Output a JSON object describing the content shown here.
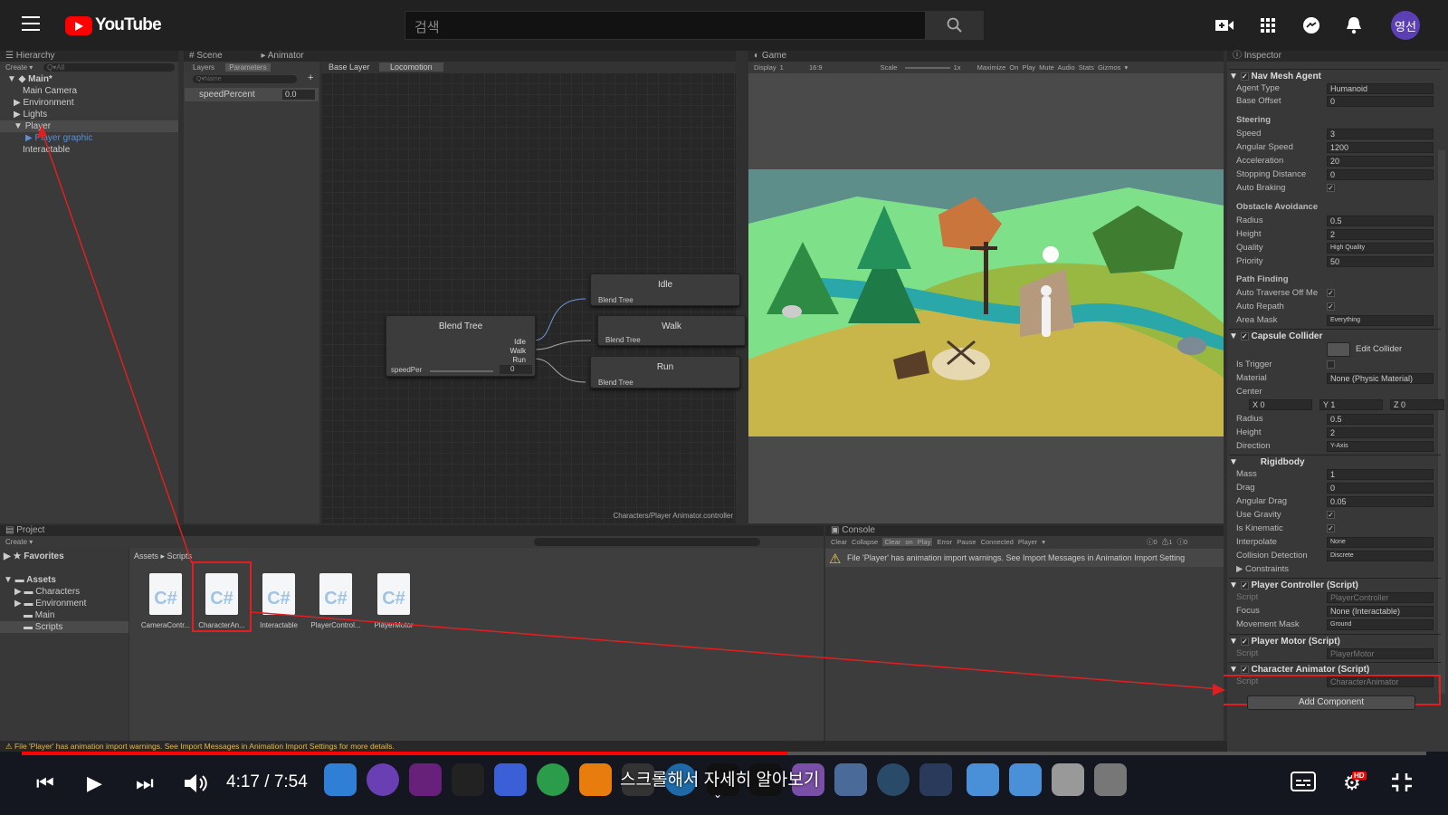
{
  "youtube": {
    "logo_text": "YouTube",
    "search_placeholder": "검색",
    "avatar": "영선",
    "icons": [
      "menu-icon",
      "search-icon",
      "create-video-icon",
      "apps-icon",
      "messages-icon",
      "bell-icon"
    ]
  },
  "hierarchy": {
    "tab": "Hierarchy",
    "create": "Create ▾",
    "search_placeholder": "Q▾All",
    "scene": "Main*",
    "items": [
      "Main Camera",
      "Environment",
      "Lights",
      "Player",
      "Player graphic",
      "Interactable"
    ]
  },
  "animator": {
    "tabs": [
      "Scene",
      "Animator"
    ],
    "subtabs": [
      "Layers",
      "Parameters"
    ],
    "name_placeholder": "Q▾Name",
    "param_name": "speedPercent",
    "param_value": "0.0",
    "breadcrumb": [
      "Base Layer",
      "Locomotion"
    ],
    "footer": "Characters/Player Animator.controller",
    "blend_tree": {
      "title": "Blend Tree",
      "outputs": [
        "Idle",
        "Walk",
        "Run"
      ],
      "param": "speedPer",
      "value": "0"
    },
    "nodes": [
      {
        "title": "Idle",
        "sub": "Blend Tree"
      },
      {
        "title": "Walk",
        "sub": "Blend Tree"
      },
      {
        "title": "Run",
        "sub": "Blend Tree"
      }
    ]
  },
  "game": {
    "tab": "Game",
    "toolbar": [
      "Display 1",
      "16:9",
      "Scale",
      "1x",
      "Maximize On Play",
      "Mute Audio",
      "Stats",
      "Gizmos ▾"
    ]
  },
  "inspector": {
    "tab": "Inspector",
    "nav_mesh_agent": {
      "title": "Nav Mesh Agent",
      "agent_type": [
        "Agent Type",
        "Humanoid"
      ],
      "base_offset": [
        "Base Offset",
        "0"
      ],
      "steering_label": "Steering",
      "steering": [
        [
          "Speed",
          "3"
        ],
        [
          "Angular Speed",
          "1200"
        ],
        [
          "Acceleration",
          "20"
        ],
        [
          "Stopping Distance",
          "0"
        ],
        [
          "Auto Braking",
          "✓"
        ]
      ],
      "obstacle_label": "Obstacle Avoidance",
      "obstacle": [
        [
          "Radius",
          "0.5"
        ],
        [
          "Height",
          "2"
        ],
        [
          "Quality",
          "High Quality"
        ],
        [
          "Priority",
          "50"
        ]
      ],
      "path_label": "Path Finding",
      "path": [
        [
          "Auto Traverse Off Me",
          "✓"
        ],
        [
          "Auto Repath",
          "✓"
        ],
        [
          "Area Mask",
          "Everything"
        ]
      ]
    },
    "capsule": {
      "title": "Capsule Collider",
      "edit": "Edit Collider",
      "rows": [
        [
          "Is Trigger",
          ""
        ],
        [
          "Material",
          "None (Physic Material)"
        ]
      ],
      "center": "Center",
      "center_vals": [
        "X 0",
        "Y 1",
        "Z 0"
      ],
      "rows2": [
        [
          "Radius",
          "0.5"
        ],
        [
          "Height",
          "2"
        ],
        [
          "Direction",
          "Y-Axis"
        ]
      ]
    },
    "rigidbody": {
      "title": "Rigidbody",
      "rows": [
        [
          "Mass",
          "1"
        ],
        [
          "Drag",
          "0"
        ],
        [
          "Angular Drag",
          "0.05"
        ],
        [
          "Use Gravity",
          "✓"
        ],
        [
          "Is Kinematic",
          "✓"
        ],
        [
          "Interpolate",
          "None"
        ],
        [
          "Collision Detection",
          "Discrete"
        ]
      ],
      "constraints": "Constraints"
    },
    "player_controller": {
      "title": "Player Controller (Script)",
      "rows": [
        [
          "Script",
          "PlayerController"
        ],
        [
          "Focus",
          "None (Interactable)"
        ],
        [
          "Movement Mask",
          "Ground"
        ]
      ]
    },
    "player_motor": {
      "title": "Player Motor (Script)",
      "rows": [
        [
          "Script",
          "PlayerMotor"
        ]
      ]
    },
    "character_animator": {
      "title": "Character Animator (Script)",
      "rows": [
        [
          "Script",
          "CharacterAnimator"
        ]
      ]
    },
    "add_component": "Add Component"
  },
  "project": {
    "tab": "Project",
    "create": "Create ▾",
    "favorites": "Favorites",
    "assets": "Assets",
    "folders": [
      "Characters",
      "Environment",
      "Main",
      "Scripts"
    ],
    "breadcrumb": [
      "Assets",
      "Scripts"
    ],
    "files": [
      "CameraContr...",
      "CharacterAn...",
      "Interactable",
      "PlayerControl...",
      "PlayerMotor"
    ],
    "file_glyph": "C#"
  },
  "console": {
    "tab": "Console",
    "buttons": [
      "Clear",
      "Collapse",
      "Clear on Play",
      "Error Pause",
      "Connected Player ▾"
    ],
    "counts": [
      "0",
      "1",
      "0"
    ],
    "message": "File 'Player' has animation import warnings. See Import Messages in Animation Import Setting"
  },
  "status_bar": "File 'Player' has animation import warnings. See Import Messages in Animation Import Settings for more details.",
  "player": {
    "time": "4:17 / 7:54",
    "progress": 0.545,
    "subtitle": "스크롤해서 자세히 알아보기",
    "hd": "HD"
  },
  "colors": {
    "youtube_red": "#ff0000",
    "highlight_red": "#e02020",
    "unity_dark": "#303030"
  }
}
